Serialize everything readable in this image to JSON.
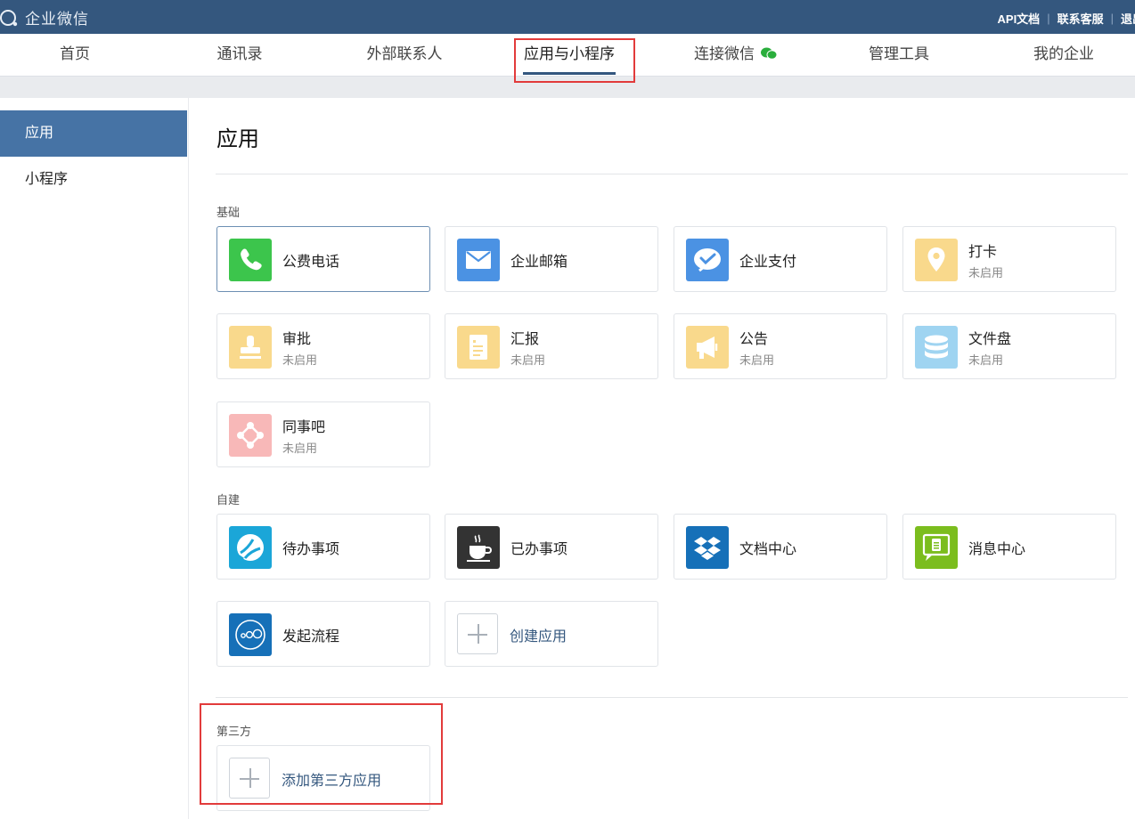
{
  "header": {
    "logo_text": "企业微信",
    "links": [
      "API文档",
      "联系客服",
      "退出"
    ]
  },
  "nav": {
    "items": [
      "首页",
      "通讯录",
      "外部联系人",
      "应用与小程序",
      "连接微信",
      "管理工具",
      "我的企业"
    ],
    "active_index": 3
  },
  "sidebar": {
    "items": [
      "应用",
      "小程序"
    ],
    "active_index": 0
  },
  "main": {
    "title": "应用",
    "sections": {
      "basic": {
        "label": "基础",
        "apps": [
          {
            "name": "公费电话",
            "status": "",
            "icon": "phone-icon"
          },
          {
            "name": "企业邮箱",
            "status": "",
            "icon": "mail-icon"
          },
          {
            "name": "企业支付",
            "status": "",
            "icon": "payment-icon"
          },
          {
            "name": "打卡",
            "status": "未启用",
            "icon": "location-pin-icon"
          },
          {
            "name": "审批",
            "status": "未启用",
            "icon": "stamp-icon"
          },
          {
            "name": "汇报",
            "status": "未启用",
            "icon": "report-icon"
          },
          {
            "name": "公告",
            "status": "未启用",
            "icon": "megaphone-icon"
          },
          {
            "name": "文件盘",
            "status": "未启用",
            "icon": "database-icon"
          },
          {
            "name": "同事吧",
            "status": "未启用",
            "icon": "network-icon"
          }
        ]
      },
      "custom": {
        "label": "自建",
        "apps": [
          {
            "name": "待办事项",
            "icon": "todo-icon"
          },
          {
            "name": "已办事项",
            "icon": "coffee-cup-icon"
          },
          {
            "name": "文档中心",
            "icon": "dropbox-icon"
          },
          {
            "name": "消息中心",
            "icon": "message-icon"
          },
          {
            "name": "发起流程",
            "icon": "flow-icon"
          }
        ],
        "create_label": "创建应用"
      },
      "third_party": {
        "label": "第三方",
        "add_label": "添加第三方应用"
      }
    }
  },
  "colors": {
    "header_bg": "#34577e",
    "sidebar_active": "#4673a5",
    "highlight_box": "#e23b3b",
    "link": "#34577e"
  }
}
